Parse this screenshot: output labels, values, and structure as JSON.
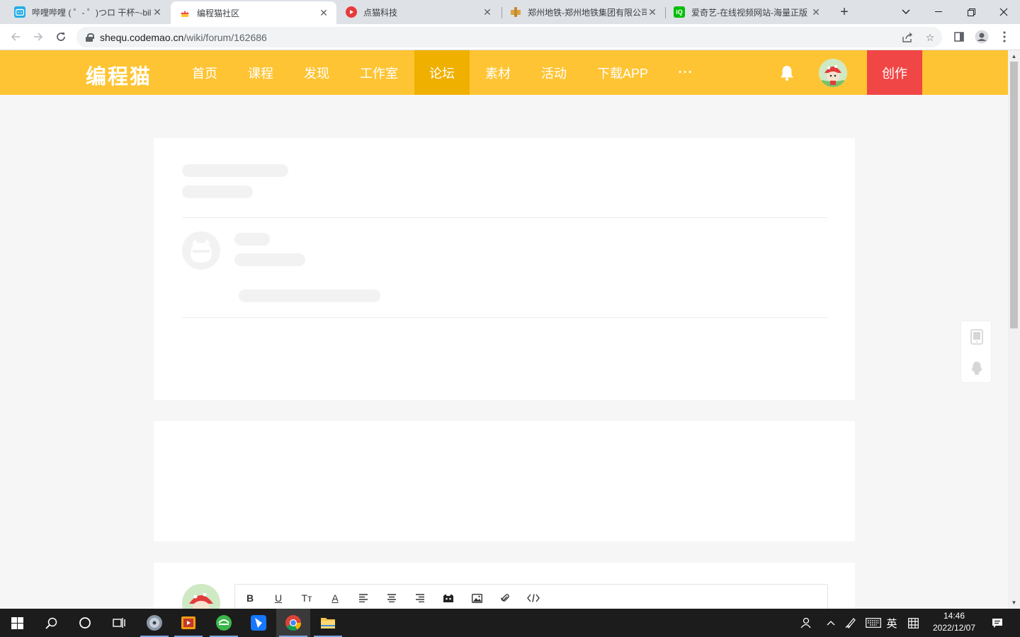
{
  "browser": {
    "tabs": [
      {
        "title": "哔哩哔哩 ( ゜- ゜)つロ 干杯~-bil",
        "favicon": "bilibili-icon",
        "color": "#23ade5"
      },
      {
        "title": "编程猫社区",
        "favicon": "codemao-icon",
        "color": "#f04646"
      },
      {
        "title": "点猫科技",
        "favicon": "diancat-icon",
        "color": "#e83a3a"
      },
      {
        "title": "郑州地铁-郑州地铁集团有限公司",
        "favicon": "zzmetro-icon",
        "color": "#d9a441"
      },
      {
        "title": "爱奇艺-在线视频网站-海量正版",
        "favicon": "iqiyi-icon",
        "color": "#00be06"
      }
    ],
    "active_tab": 1,
    "url_host": "shequ.codemao.cn",
    "url_path": "/wiki/forum/162686"
  },
  "site": {
    "logo": "编程猫",
    "nav": [
      "首页",
      "课程",
      "发现",
      "工作室",
      "论坛",
      "素材",
      "活动",
      "下载APP"
    ],
    "more": "···",
    "active_nav": 4,
    "create_label": "创作",
    "brand_color": "#fec433",
    "create_color": "#f04646"
  },
  "editor": {
    "tools": [
      "B",
      "U",
      "Tт",
      "A"
    ]
  },
  "taskbar": {
    "ime": "英",
    "time": "14:46",
    "date": "2022/12/07"
  }
}
